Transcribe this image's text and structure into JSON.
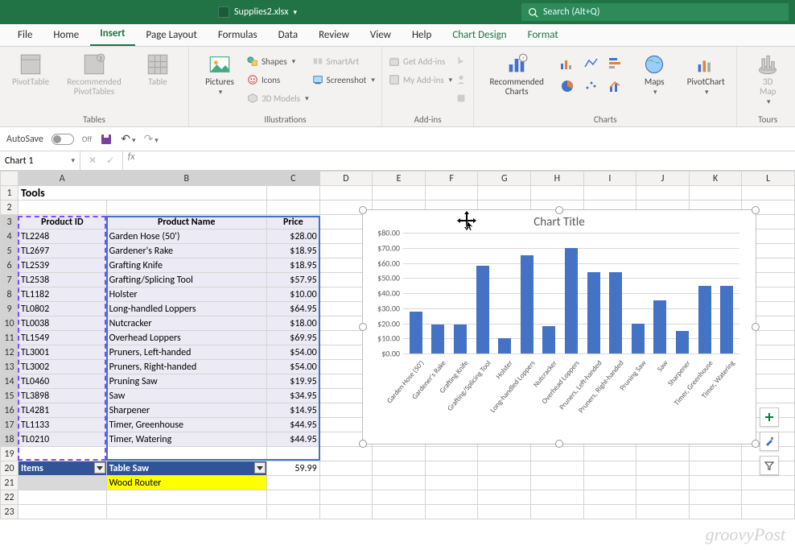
{
  "title": {
    "filename": "Supplies2.xlsx",
    "search_placeholder": "Search (Alt+Q)"
  },
  "tabs": {
    "file": "File",
    "home": "Home",
    "insert": "Insert",
    "pagelayout": "Page Layout",
    "formulas": "Formulas",
    "data": "Data",
    "review": "Review",
    "view": "View",
    "help": "Help",
    "chartdesign": "Chart Design",
    "format": "Format"
  },
  "ribbon": {
    "tables": {
      "name": "Tables",
      "pivot": "PivotTable",
      "recpivot": "Recommended\nPivotTables",
      "table": "Table"
    },
    "illus": {
      "name": "Illustrations",
      "pictures": "Pictures",
      "shapes": "Shapes",
      "icons": "Icons",
      "models": "3D Models",
      "smartart": "SmartArt",
      "screenshot": "Screenshot"
    },
    "addins": {
      "name": "Add-ins",
      "get": "Get Add-ins",
      "my": "My Add-ins"
    },
    "charts": {
      "name": "Charts",
      "rec": "Recommended\nCharts",
      "maps": "Maps",
      "pivotchart": "PivotChart"
    },
    "tours": {
      "name": "Tours",
      "map3d": "3D\nMap"
    }
  },
  "qat": {
    "autosave": "AutoSave",
    "off": "Off"
  },
  "namebox": "Chart 1",
  "sheet": {
    "cols": [
      "A",
      "B",
      "C",
      "D",
      "E",
      "F",
      "G",
      "H",
      "I",
      "J",
      "K",
      "L"
    ],
    "a1": "Tools",
    "headers": {
      "pid": "Product ID",
      "pname": "Product Name",
      "price": "Price"
    },
    "rows": [
      {
        "id": "TL2248",
        "name": "Garden Hose (50')",
        "price": "$28.00"
      },
      {
        "id": "TL2697",
        "name": "Gardener's Rake",
        "price": "$18.95"
      },
      {
        "id": "TL2539",
        "name": "Grafting Knife",
        "price": "$18.95"
      },
      {
        "id": "TL2538",
        "name": "Grafting/Splicing Tool",
        "price": "$57.95"
      },
      {
        "id": "TL1182",
        "name": "Holster",
        "price": "$10.00"
      },
      {
        "id": "TL0802",
        "name": "Long-handled Loppers",
        "price": "$64.95"
      },
      {
        "id": "TL0038",
        "name": "Nutcracker",
        "price": "$18.00"
      },
      {
        "id": "TL1549",
        "name": "Overhead Loppers",
        "price": "$69.95"
      },
      {
        "id": "TL3001",
        "name": "Pruners, Left-handed",
        "price": "$54.00"
      },
      {
        "id": "TL3002",
        "name": "Pruners, Right-handed",
        "price": "$54.00"
      },
      {
        "id": "TL0460",
        "name": "Pruning Saw",
        "price": "$19.95"
      },
      {
        "id": "TL3898",
        "name": "Saw",
        "price": "$34.95"
      },
      {
        "id": "TL4281",
        "name": "Sharpener",
        "price": "$14.95"
      },
      {
        "id": "TL1133",
        "name": "Timer, Greenhouse",
        "price": "$44.95"
      },
      {
        "id": "TL0210",
        "name": "Timer, Watering",
        "price": "$44.95"
      }
    ],
    "row20": {
      "a": "Items",
      "b": "Table Saw",
      "c": "59.99"
    },
    "row21": {
      "b": "Wood Router"
    }
  },
  "chart_data": {
    "type": "bar",
    "title": "Chart Title",
    "categories": [
      "Garden Hose (50')",
      "Gardener's Rake",
      "Grafting Knife",
      "Grafting/Splicing Tool",
      "Holster",
      "Long-handled Loppers",
      "Nutcracker",
      "Overhead Loppers",
      "Pruners, Left-handed",
      "Pruners, Right-handed",
      "Pruning Saw",
      "Saw",
      "Sharpener",
      "Timer, Greenhouse",
      "Timer, Watering"
    ],
    "values": [
      28.0,
      18.95,
      18.95,
      57.95,
      10.0,
      64.95,
      18.0,
      69.95,
      54.0,
      54.0,
      19.95,
      34.95,
      14.95,
      44.95,
      44.95
    ],
    "ylabel": "",
    "xlabel": "",
    "ylim": [
      0,
      80
    ],
    "yticks": [
      "$0.00",
      "$10.00",
      "$20.00",
      "$30.00",
      "$40.00",
      "$50.00",
      "$60.00",
      "$70.00",
      "$80.00"
    ]
  },
  "watermark": "groovyPost"
}
